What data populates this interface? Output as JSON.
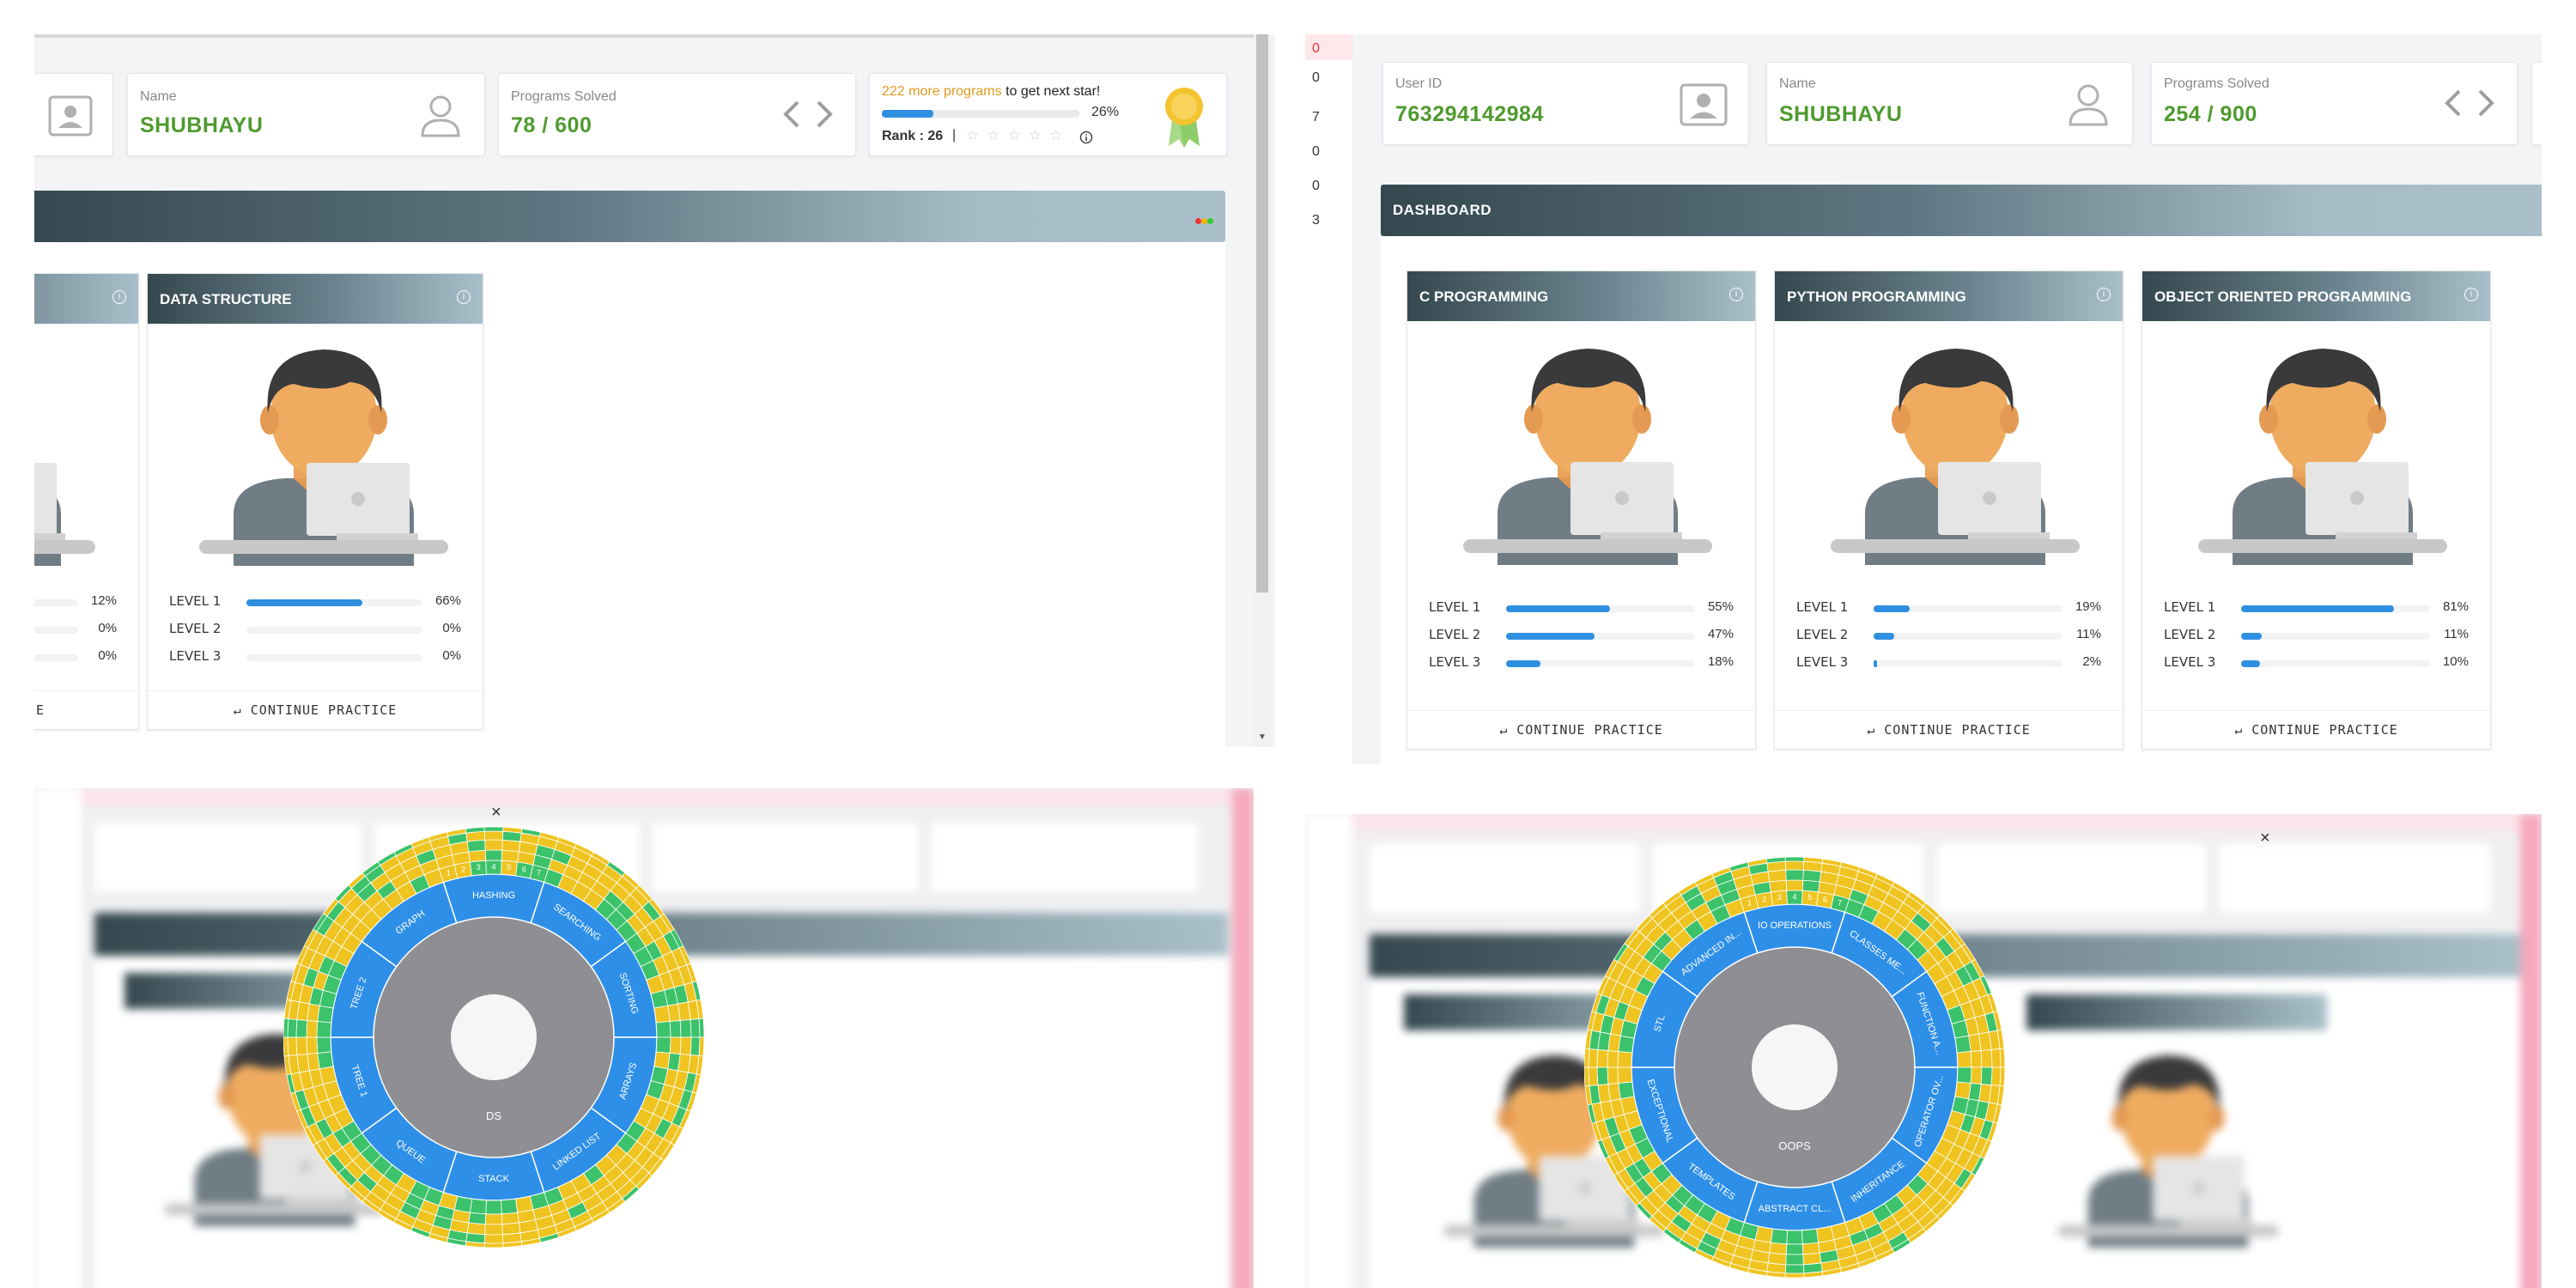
{
  "colors": {
    "accent": "#2f8fe0",
    "value_green": "#4f9a2f",
    "header_dark": "#35484f",
    "sunburst_yellow": "#efc420",
    "sunburst_green": "#3cc26a",
    "sunburst_blue": "#2e8fe8",
    "sunburst_grey": "#8f8f93"
  },
  "panel1": {
    "name_label": "Name",
    "name_value": "SHUBHAYU",
    "programs_label": "Programs Solved",
    "programs_value": "78 / 600",
    "star": {
      "more_count": "222 more programs",
      "to_get": " to get next star!",
      "percent": "26%",
      "progress": 0.26,
      "rank": "Rank : 26",
      "separator": "|"
    },
    "continue": "CONTINUE PRACTICE",
    "partial_course": {
      "levels": [
        {
          "pct": "12%",
          "value": 0.12
        },
        {
          "pct": "0%",
          "value": 0
        },
        {
          "pct": "0%",
          "value": 0
        }
      ],
      "continue_tail": "E"
    },
    "course": {
      "title": "DATA STRUCTURE",
      "levels": [
        {
          "name": "LEVEL 1",
          "pct": "66%",
          "value": 0.66
        },
        {
          "name": "LEVEL 2",
          "pct": "0%",
          "value": 0
        },
        {
          "name": "LEVEL 3",
          "pct": "0%",
          "value": 0
        }
      ],
      "continue": "CONTINUE PRACTICE"
    }
  },
  "panel2": {
    "left_digits": [
      "0",
      "0",
      "7",
      "0",
      "0",
      "3"
    ],
    "user_label": "User ID",
    "user_value": "763294142984",
    "name_label": "Name",
    "name_value": "SHUBHAYU",
    "programs_label": "Programs Solved",
    "programs_value": "254 / 900",
    "dashboard": "DASHBOARD",
    "courses": [
      {
        "title": "C PROGRAMMING",
        "levels": [
          {
            "name": "LEVEL 1",
            "pct": "55%",
            "value": 0.55
          },
          {
            "name": "LEVEL 2",
            "pct": "47%",
            "value": 0.47
          },
          {
            "name": "LEVEL 3",
            "pct": "18%",
            "value": 0.18
          }
        ],
        "continue": "CONTINUE PRACTICE"
      },
      {
        "title": "PYTHON PROGRAMMING",
        "levels": [
          {
            "name": "LEVEL 1",
            "pct": "19%",
            "value": 0.19
          },
          {
            "name": "LEVEL 2",
            "pct": "11%",
            "value": 0.11
          },
          {
            "name": "LEVEL 3",
            "pct": "2%",
            "value": 0.02
          }
        ],
        "continue": "CONTINUE PRACTICE"
      },
      {
        "title": "OBJECT ORIENTED PROGRAMMING",
        "levels": [
          {
            "name": "LEVEL 1",
            "pct": "81%",
            "value": 0.81
          },
          {
            "name": "LEVEL 2",
            "pct": "11%",
            "value": 0.11
          },
          {
            "name": "LEVEL 3",
            "pct": "10%",
            "value": 0.1
          }
        ],
        "continue": "CONTINUE PRACTICE"
      }
    ]
  },
  "panel3": {
    "center_label": "DS",
    "close": "×",
    "segments": [
      "HASHING",
      "SEARCHING",
      "SORTING",
      "ARRAYS",
      "LINKED LIST",
      "STACK",
      "QUEUE",
      "TREE 1",
      "TREE 2",
      "GRAPH"
    ],
    "level_numbers": [
      "1",
      "2",
      "3",
      "4",
      "5",
      "6",
      "7"
    ]
  },
  "panel4": {
    "center_label": "OOPS",
    "close": "×",
    "segments": [
      "IO OPERATIONS",
      "CLASSES ME...",
      "FUNCTION A...",
      "OPERATOR OV...",
      "INHERITANCE",
      "ABSTRACT CL...",
      "TEMPLATES",
      "EXCEPTIONAL",
      "STL",
      "ADVANCED IN..."
    ],
    "level_numbers": [
      "1",
      "2",
      "3",
      "4",
      "5",
      "6",
      "7"
    ]
  }
}
